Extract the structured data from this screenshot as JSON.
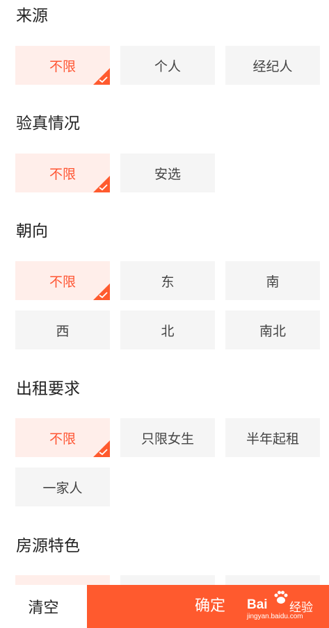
{
  "colors": {
    "accent": "#ff5a2e",
    "selected_bg": "#ffeeea",
    "option_bg": "#f5f5f5"
  },
  "sections": [
    {
      "title": "来源",
      "options": [
        {
          "label": "不限",
          "selected": true
        },
        {
          "label": "个人",
          "selected": false
        },
        {
          "label": "经纪人",
          "selected": false
        }
      ]
    },
    {
      "title": "验真情况",
      "options": [
        {
          "label": "不限",
          "selected": true
        },
        {
          "label": "安选",
          "selected": false
        }
      ]
    },
    {
      "title": "朝向",
      "options": [
        {
          "label": "不限",
          "selected": true
        },
        {
          "label": "东",
          "selected": false
        },
        {
          "label": "南",
          "selected": false
        },
        {
          "label": "西",
          "selected": false
        },
        {
          "label": "北",
          "selected": false
        },
        {
          "label": "南北",
          "selected": false
        }
      ]
    },
    {
      "title": "出租要求",
      "options": [
        {
          "label": "不限",
          "selected": true
        },
        {
          "label": "只限女生",
          "selected": false
        },
        {
          "label": "半年起租",
          "selected": false
        },
        {
          "label": "一家人",
          "selected": false
        }
      ]
    },
    {
      "title": "房源特色",
      "options": []
    }
  ],
  "footer": {
    "clear_label": "清空",
    "confirm_label": "确定"
  },
  "watermark": {
    "logo": "Bai",
    "site": "经验",
    "url": "jingyan.baidu.com"
  }
}
